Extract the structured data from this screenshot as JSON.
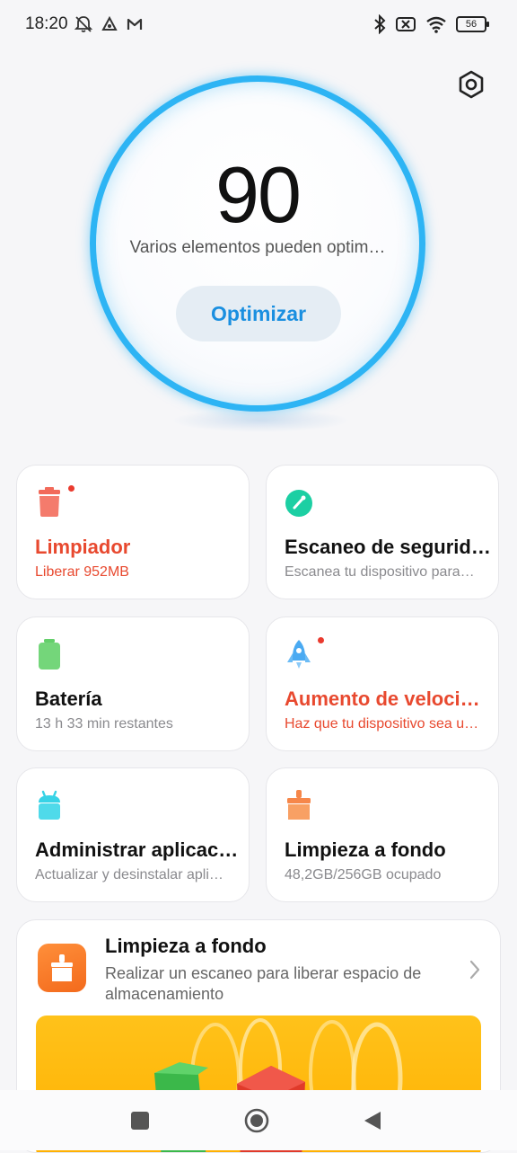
{
  "status_bar": {
    "time": "18:20",
    "left_icons": [
      "notifications-muted-icon",
      "app-notification-icon",
      "gmail-icon"
    ],
    "right_icons": [
      "bluetooth-icon",
      "sim-missing-icon",
      "wifi-icon"
    ],
    "battery": "56"
  },
  "score": {
    "value": "90",
    "message": "Varios elementos pueden optim…",
    "button_label": "Optimizar",
    "ring_color": "#2db4f4"
  },
  "tiles": [
    {
      "title": "Limpiador",
      "subtitle": "Liberar 952MB",
      "icon": "trash-bin-icon",
      "alert": true
    },
    {
      "title": "Escaneo de segurid…",
      "subtitle": "Escanea tu dispositivo para…",
      "icon": "security-scan-icon",
      "alert": false
    },
    {
      "title": "Batería",
      "subtitle": "13 h 33 min  restantes",
      "icon": "battery-icon",
      "alert": false
    },
    {
      "title": "Aumento de veloci…",
      "subtitle": "Haz que tu dispositivo sea u…",
      "icon": "rocket-icon",
      "alert": true
    },
    {
      "title": "Administrar aplicac…",
      "subtitle": "Actualizar y desinstalar apli…",
      "icon": "android-apps-icon",
      "alert": false
    },
    {
      "title": "Limpieza a fondo",
      "subtitle": "48,2GB/256GB ocupado",
      "icon": "deep-clean-brush-icon",
      "alert": false
    }
  ],
  "promo": {
    "title": "Limpieza a fondo",
    "description": "Realizar un escaneo para liberar espacio de almacenamiento",
    "icon": "deep-clean-brush-icon"
  },
  "colors": {
    "alert_red": "#e8492f",
    "accent_blue": "#1a8fe0",
    "trash_icon": "#f26a5a",
    "security_icon": "#1ccfa3",
    "battery_icon": "#63cf6a",
    "rocket_icon": "#4aaaf2",
    "android_icon": "#37d3e6",
    "brush_icon": "#f6874a",
    "banner": "#ffc21a"
  }
}
